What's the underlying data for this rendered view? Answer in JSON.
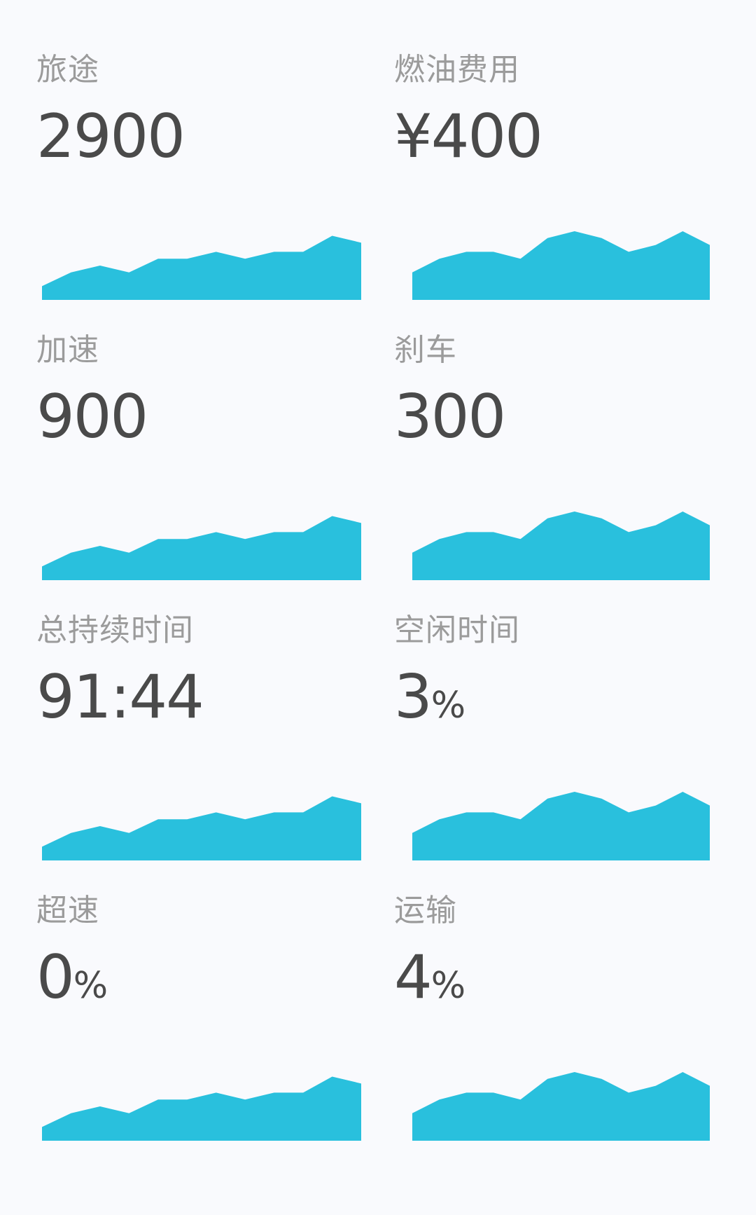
{
  "accent_color": "#29c0dd",
  "cards": [
    {
      "id": "trip",
      "label": "旅途",
      "value": "2900",
      "unit": "",
      "sparkline": "a"
    },
    {
      "id": "fuel-cost",
      "label": "燃油费用",
      "value": "¥400",
      "unit": "",
      "sparkline": "b"
    },
    {
      "id": "acceleration",
      "label": "加速",
      "value": "900",
      "unit": "",
      "sparkline": "a"
    },
    {
      "id": "braking",
      "label": "刹车",
      "value": "300",
      "unit": "",
      "sparkline": "b"
    },
    {
      "id": "total-duration",
      "label": "总持续时间",
      "value": "91:44",
      "unit": "",
      "sparkline": "a"
    },
    {
      "id": "idle-time",
      "label": "空闲时间",
      "value": "3",
      "unit": "%",
      "sparkline": "b"
    },
    {
      "id": "speeding",
      "label": "超速",
      "value": "0",
      "unit": "%",
      "sparkline": "a"
    },
    {
      "id": "transport",
      "label": "运输",
      "value": "4",
      "unit": "%",
      "sparkline": "b"
    }
  ],
  "chart_data": [
    {
      "type": "area",
      "id": "a",
      "title": "",
      "xlabel": "",
      "ylabel": "",
      "grid": false,
      "x": [
        0,
        1,
        2,
        3,
        4,
        5,
        6,
        7,
        8,
        9,
        10,
        11
      ],
      "values": [
        3,
        6,
        7.5,
        6,
        9,
        9,
        10.5,
        9,
        10.5,
        10.5,
        14,
        12.5
      ],
      "ylim": [
        0,
        15
      ]
    },
    {
      "type": "area",
      "id": "b",
      "title": "",
      "xlabel": "",
      "ylabel": "",
      "grid": false,
      "x": [
        0,
        1,
        2,
        3,
        4,
        5,
        6,
        7,
        8,
        9,
        10,
        11
      ],
      "values": [
        6,
        9,
        10.5,
        10.5,
        9,
        13.5,
        15,
        13.5,
        10.5,
        12,
        15,
        12
      ],
      "ylim": [
        0,
        15
      ]
    }
  ]
}
